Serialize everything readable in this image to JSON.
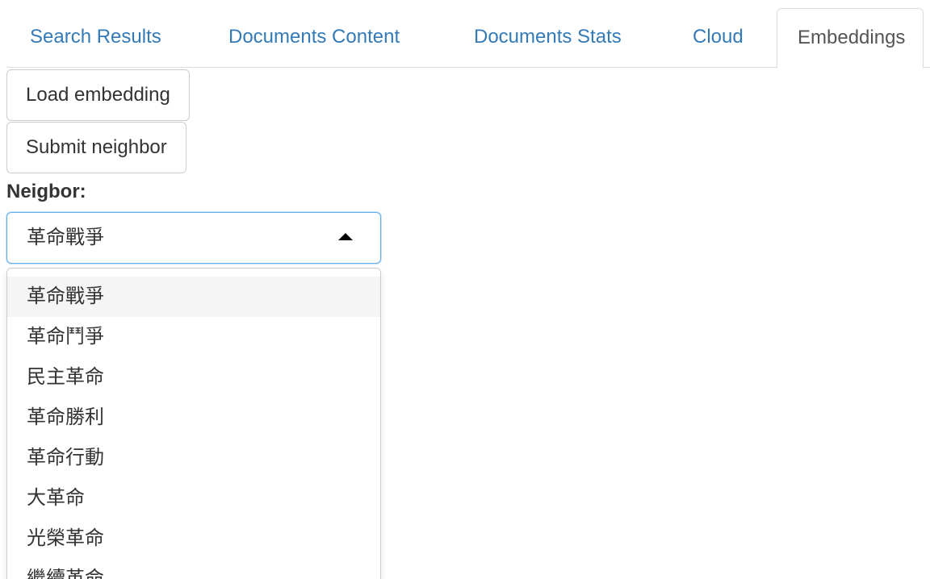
{
  "tabs": [
    {
      "label": "Search Results",
      "active": false
    },
    {
      "label": "Documents Content",
      "active": false
    },
    {
      "label": "Documents Stats",
      "active": false
    },
    {
      "label": "Cloud",
      "active": false
    },
    {
      "label": "Embeddings",
      "active": true
    }
  ],
  "buttons": {
    "load_embedding": "Load embedding",
    "submit_neighbor": "Submit neighbor"
  },
  "neighbor_field": {
    "label": "Neigbor:",
    "selected": "革命戰爭",
    "options": [
      "革命戰爭",
      "革命鬥爭",
      "民主革命",
      "革命勝利",
      "革命行動",
      "大革命",
      "光榮革命",
      "繼續革命"
    ]
  },
  "colors": {
    "link": "#337ab7",
    "active_tab_text": "#555555",
    "focus_border": "#66afe9",
    "highlight_bg": "#f5f5f5"
  },
  "icons": {
    "select_caret": "caret-up-icon"
  }
}
